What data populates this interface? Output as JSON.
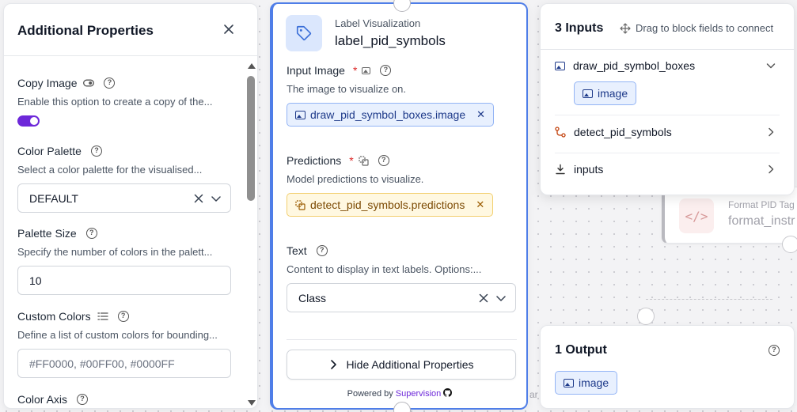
{
  "left_panel": {
    "title": "Additional Properties",
    "fields": {
      "copy_image": {
        "label": "Copy Image",
        "desc": "Enable this option to create a copy of the...",
        "enabled": true
      },
      "color_palette": {
        "label": "Color Palette",
        "desc": "Select a color palette for the visualised...",
        "value": "DEFAULT"
      },
      "palette_size": {
        "label": "Palette Size",
        "desc": "Specify the number of colors in the palett...",
        "value": "10"
      },
      "custom_colors": {
        "label": "Custom Colors",
        "desc": "Define a list of custom colors for bounding...",
        "placeholder": "#FF0000, #00FF00, #0000FF"
      },
      "color_axis": {
        "label": "Color Axis"
      }
    }
  },
  "node": {
    "category": "Label Visualization",
    "name": "label_pid_symbols",
    "input_image": {
      "label": "Input Image",
      "required": "*",
      "desc": "The image to visualize on.",
      "chip": "draw_pid_symbol_boxes.image"
    },
    "predictions": {
      "label": "Predictions",
      "required": "*",
      "desc": "Model predictions to visualize.",
      "chip": "detect_pid_symbols.predictions"
    },
    "text": {
      "label": "Text",
      "desc": "Content to display in text labels. Options:...",
      "value": "Class"
    },
    "hide_button": "Hide Additional Properties",
    "powered_by": "Powered by",
    "powered_brand": "Supervision"
  },
  "inputs_panel": {
    "title": "3 Inputs",
    "hint": "Drag to block fields to connect",
    "items": [
      {
        "name": "draw_pid_symbol_boxes",
        "chip": "image"
      },
      {
        "name": "detect_pid_symbols"
      },
      {
        "name": "inputs"
      }
    ]
  },
  "background_node": {
    "category": "Format PID Tag",
    "name": "format_instr"
  },
  "output_panel": {
    "title": "1 Output",
    "chip": "image"
  },
  "canvas_fragment": "ar",
  "colors": {
    "accent": "#6d28d9",
    "node_border": "#4f7ee8",
    "chip_blue": "#e8f0fe",
    "chip_amber": "#fff8e1",
    "required": "#dc2626"
  }
}
